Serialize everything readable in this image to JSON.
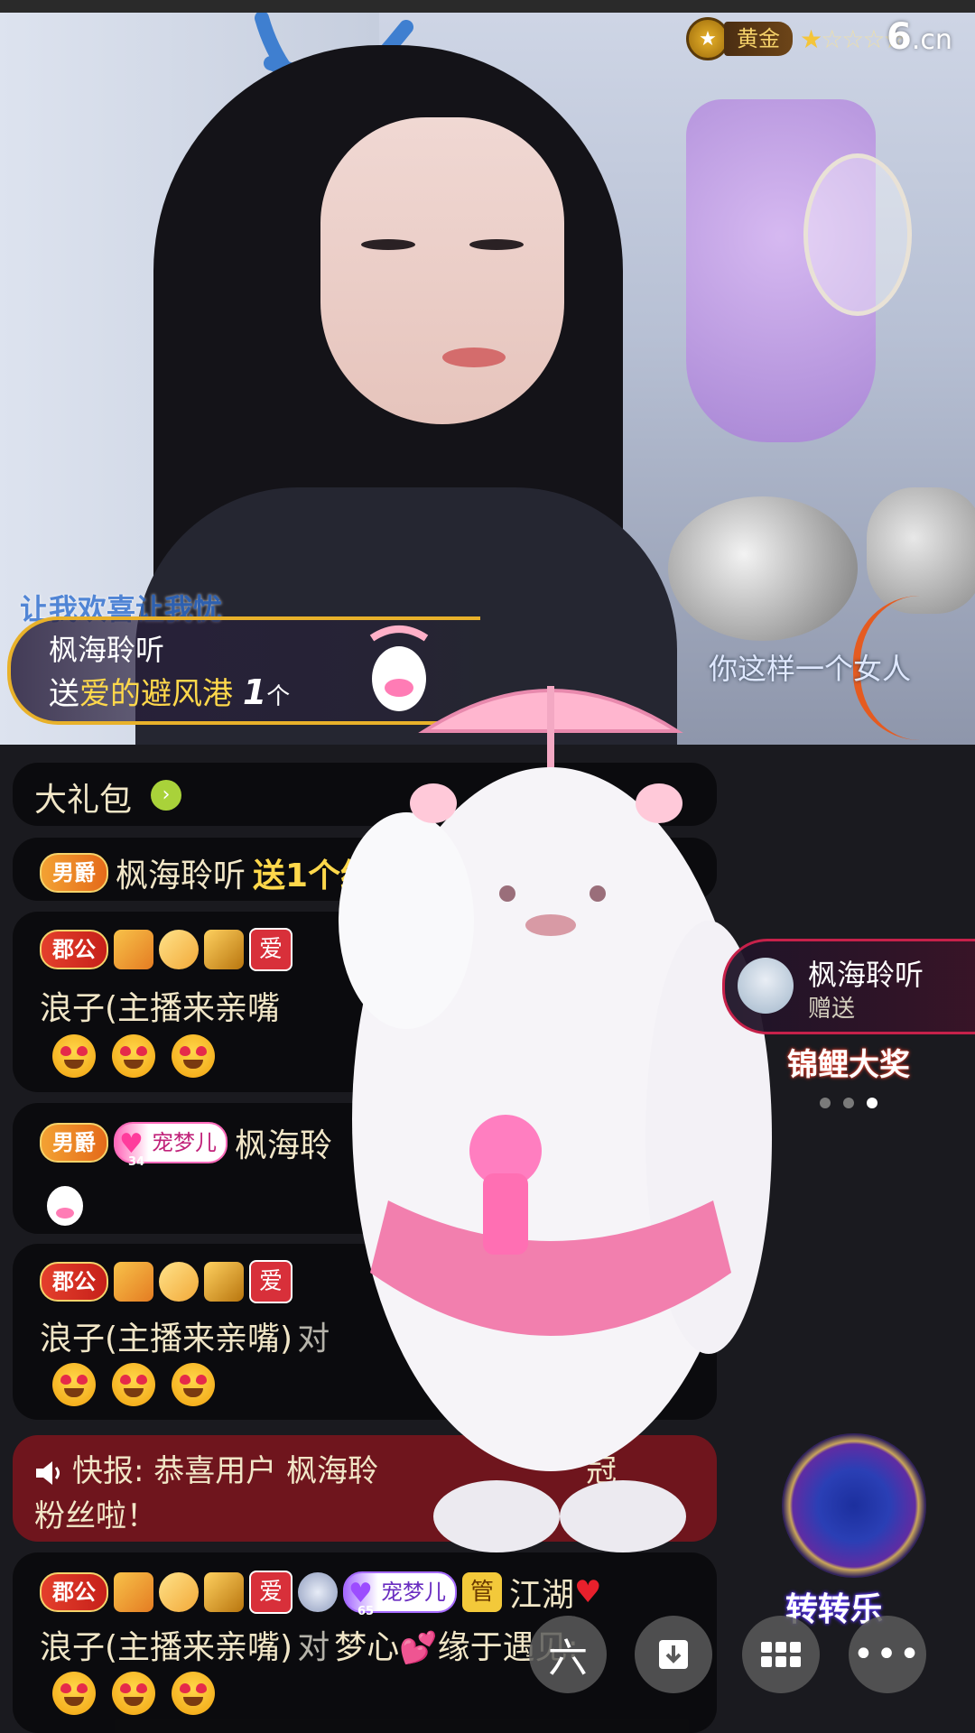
{
  "rank": {
    "label": "黄金",
    "stars_filled": 1,
    "stars_total": 5
  },
  "logo": {
    "main": "6",
    "suffix": ".cn"
  },
  "lyrics": {
    "line1": "让我欢喜让我忧",
    "line2": "你这样一个女人"
  },
  "gift_banner": {
    "sender": "枫海聆听",
    "verb": "送",
    "gift_name": "爱的避风港",
    "count": "1",
    "unit": "个"
  },
  "package": {
    "label": "大礼包",
    "go": "›"
  },
  "messages": [
    {
      "badge": "男爵",
      "user": "枫海聆听",
      "action": "送1个红包"
    },
    {
      "badge": "郡公",
      "love": "爱",
      "text": "浪子(主播来亲嘴",
      "emoji_count": 3
    },
    {
      "badge": "男爵",
      "fan_badge": "宠梦儿",
      "fan_level": "34",
      "user": "枫海聆"
    },
    {
      "badge": "郡公",
      "love": "爱",
      "text": "浪子(主播来亲嘴)",
      "text2": "对",
      "emoji_count": 3
    },
    {
      "badge": "郡公",
      "love": "爱",
      "fan_badge": "宠梦儿",
      "fan_level": "65",
      "guan": "管",
      "user": "江湖",
      "text": "浪子(主播来亲嘴)",
      "text2": "对",
      "target": "梦心",
      "tail": "缘于遇见:",
      "emoji_count": 3
    }
  ],
  "news": {
    "line1": "快报: 恭喜用户 枫海聆",
    "line1_end": "冠",
    "line2": "粉丝啦！"
  },
  "side_notify": {
    "name": "枫海聆听",
    "action": "赠送",
    "prize": "锦鲤大奖"
  },
  "turntable": {
    "label": "转转乐"
  },
  "bottom": {
    "b1": "六",
    "b4": "•••"
  },
  "colors": {
    "accent_gold": "#ffd84b",
    "banner_border": "#e8b12a",
    "news_bg": "#8c141e"
  }
}
